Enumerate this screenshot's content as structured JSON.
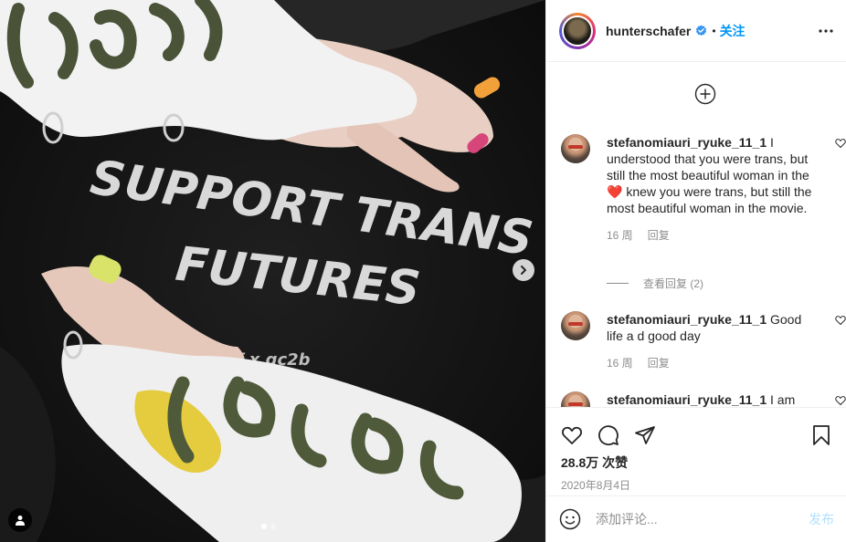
{
  "post": {
    "image_alt": "Photo with hands over black hoodie reading SUPPORT TRANS FUTURES",
    "shirt_text_line1": "SUPPORT TRANS",
    "shirt_text_line2": "FUTURES",
    "shirt_tag": "tf x gc2b",
    "carousel": {
      "count": 2,
      "active": 0
    }
  },
  "header": {
    "username": "hunterschafer",
    "bullet": "•",
    "follow_label": "关注",
    "icons": {
      "avatar": "profile-avatar",
      "verified": "verified-badge-icon",
      "more": "more-options-icon"
    }
  },
  "comments": [
    {
      "username": "stefanomiauri_ryuke_11_1",
      "text_before": "I understood that you were trans, but still the most beautiful woman in the",
      "emoji": "❤️",
      "text_after": "knew you were trans, but still the most beautiful woman in the movie.",
      "age": "16 周",
      "reply_label": "回复"
    },
    {
      "username": "stefanomiauri_ryuke_11_1",
      "text": "Good life a d good day",
      "age": "16 周",
      "reply_label": "回复"
    },
    {
      "username": "stefanomiauri_ryuke_11_1",
      "text": "I am"
    }
  ],
  "view_replies_label": "查看回复 (2)",
  "likes": "28.8万 次赞",
  "date": "2020年8月4日",
  "comment_input": {
    "placeholder": "添加评论...",
    "post_label": "发布"
  },
  "colors": {
    "accent": "#0095f6",
    "text": "#262626",
    "muted": "#8e8e8e",
    "post_disabled": "#b2dffc"
  }
}
